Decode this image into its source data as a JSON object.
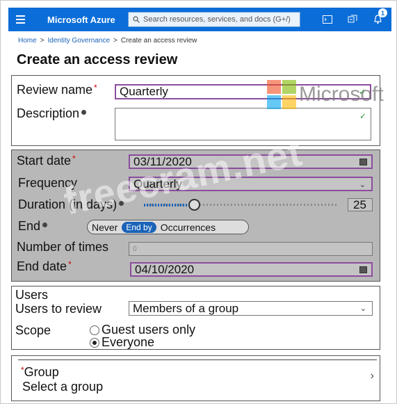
{
  "topbar": {
    "brand": "Microsoft Azure",
    "search_placeholder": "Search resources, services, and docs (G+/)",
    "notification_count": "1",
    "color": "#0b6dd8"
  },
  "breadcrumb": [
    "Home",
    "Identity Governance",
    "Create an access review"
  ],
  "title": "Create an access review",
  "review_name": {
    "label": "Review name",
    "required": "*",
    "value": "Quarterly"
  },
  "description": {
    "label": "Description",
    "value": ""
  },
  "start_date": {
    "label": "Start date",
    "required": "*",
    "value": "03/11/2020"
  },
  "frequency": {
    "label": "Frequency",
    "value": "Quarterly"
  },
  "duration": {
    "label": "Duration (in days)",
    "value": "25",
    "slider_fraction": 0.25
  },
  "end": {
    "label": "End",
    "options": [
      "Never",
      "End by",
      "Occurrences"
    ],
    "selected": "End by"
  },
  "number_of_times": {
    "label": "Number of times",
    "value": "0"
  },
  "end_date": {
    "label": "End date",
    "required": "*",
    "value": "04/10/2020"
  },
  "users": {
    "heading": "Users",
    "to_review_label": "Users to review",
    "to_review_value": "Members of a group",
    "scope_label": "Scope",
    "scope_options": [
      "Guest users only",
      "Everyone"
    ],
    "scope_selected": "Everyone"
  },
  "group": {
    "required": "*",
    "label": "Group",
    "placeholder": "Select a group"
  },
  "watermarks": {
    "logo_text": "Microsoft",
    "site": "freecram.net"
  },
  "icons": [
    "hamburger-icon",
    "search-icon",
    "cloud-shell-icon",
    "directory-filter-icon",
    "notification-bell-icon",
    "calendar-icon",
    "chevron-down-icon",
    "chevron-right-icon",
    "info-icon",
    "checkmark-icon"
  ]
}
